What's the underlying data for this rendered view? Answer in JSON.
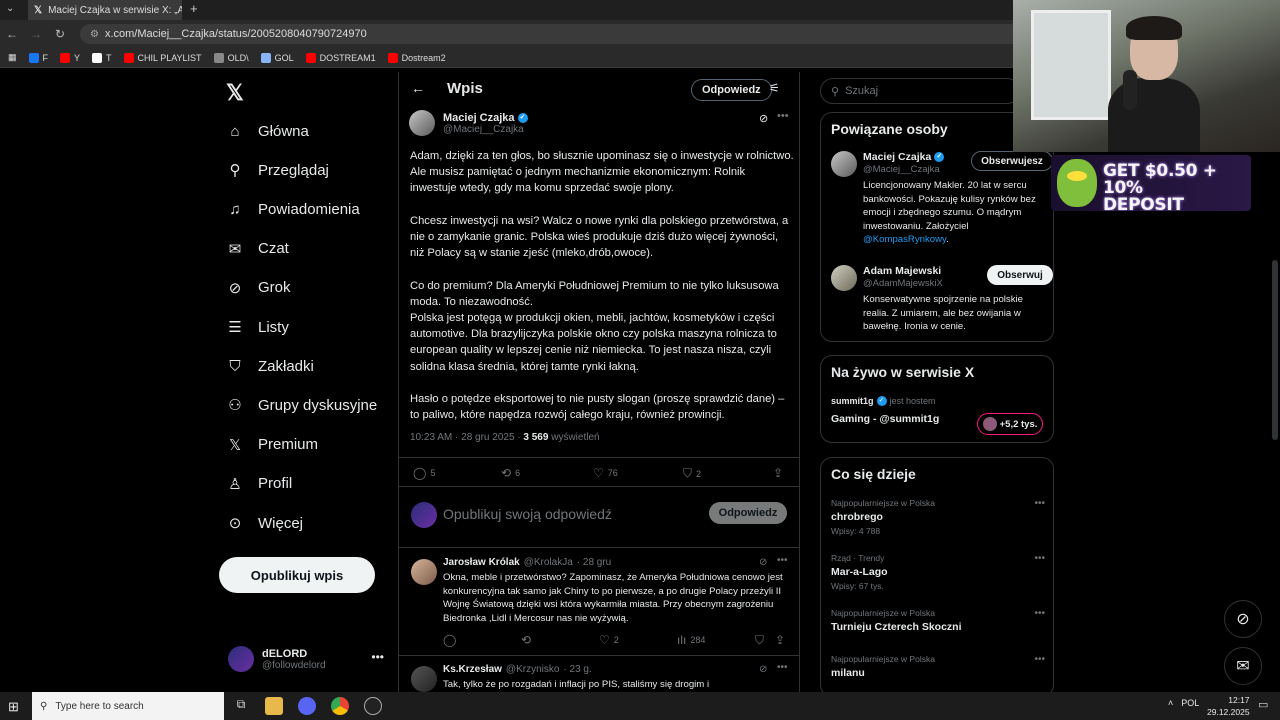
{
  "browser": {
    "tab_title": "Maciej Czajka w serwisie X: „A",
    "url": "x.com/Maciej__Czajka/status/2005208040790724970",
    "bookmarks": [
      {
        "label": "F",
        "color": "#1877f2"
      },
      {
        "label": "Y",
        "color": "#ff0000"
      },
      {
        "label": "T",
        "color": "#ffffff"
      },
      {
        "label": "CHIL PLAYLIST",
        "color": "#ff0000"
      },
      {
        "label": "OLD\\",
        "color": "#888888"
      },
      {
        "label": "GOL",
        "color": "#8ab4f8"
      },
      {
        "label": "DOSTREAM1",
        "color": "#ff0000"
      },
      {
        "label": "Dostream2",
        "color": "#ff0000"
      }
    ]
  },
  "promo": {
    "line1": "GET $0.50 + 10%",
    "line2": "DEPOSIT BONUS"
  },
  "nav": {
    "items": [
      {
        "label": "Główna",
        "icon": "home-icon"
      },
      {
        "label": "Przeglądaj",
        "icon": "search-icon"
      },
      {
        "label": "Powiadomienia",
        "icon": "bell-icon"
      },
      {
        "label": "Czat",
        "icon": "mail-icon"
      },
      {
        "label": "Grok",
        "icon": "grok-icon"
      },
      {
        "label": "Listy",
        "icon": "list-icon"
      },
      {
        "label": "Zakładki",
        "icon": "bookmark-icon"
      },
      {
        "label": "Grupy dyskusyjne",
        "icon": "people-icon"
      },
      {
        "label": "Premium",
        "icon": "x-icon"
      },
      {
        "label": "Profil",
        "icon": "person-icon"
      },
      {
        "label": "Więcej",
        "icon": "more-icon"
      }
    ],
    "post_button": "Opublikuj wpis",
    "account_name": "dELORD",
    "account_handle": "@followdelord"
  },
  "main": {
    "title": "Wpis",
    "reply_pill": "Odpowiedz",
    "author_name": "Maciej Czajka",
    "author_handle": "@Maciej__Czajka",
    "paragraphs": [
      "Adam, dzięki za ten głos, bo słusznie upominasz się o inwestycje w rolnictwo. Ale musisz pamiętać o jednym mechanizmie ekonomicznym: Rolnik inwestuje wtedy, gdy ma komu sprzedać swoje plony.",
      "Chcesz inwestycji na wsi? Walcz o nowe rynki dla polskiego przetwórstwa, a nie o zamykanie granic. Polska wieś produkuje dziś dużo więcej żywności, niż Polacy są w stanie zjeść (mleko,drób,owoce).",
      "Co do premium? Dla Ameryki Południowej Premium to nie tylko luksusowa moda. To niezawodność.\nPolska jest potęgą w produkcji okien, mebli, jachtów, kosmetyków i części automotive. Dla brazylijczyka polskie okno czy polska maszyna rolnicza to european quality w lepszej cenie niż niemiecka. To jest nasza nisza, czyli solidna klasa średnia, której tamte rynki łakną.",
      "Hasło o potędze eksportowej to nie pusty slogan (proszę sprawdzić dane) – to paliwo, które napędza rozwój całego kraju, również prowincji."
    ],
    "time": "10:23 AM · 28 gru 2025 · ",
    "views": "3 569",
    "views_label": " wyświetleń",
    "stats": {
      "replies": "5",
      "reposts": "6",
      "likes": "76",
      "bookmarks": "2"
    },
    "compose_placeholder": "Opublikuj swoją odpowiedź",
    "compose_button": "Odpowiedz",
    "replies": [
      {
        "name": "Jarosław Królak",
        "handle": "@KrolakJa",
        "time": "· 28 gru",
        "text": "Okna, meble i przetwórstwo? Zapominasz, że Ameryka Południowa cenowo jest konkurencyjna tak samo jak Chiny to po pierwsze, a po drugie Polacy przeżyli II Wojnę Światową dzięki wsi która wykarmiła miasta. Przy obecnym zagrożeniu Biedronka ,Lidl i Mercosur nas nie wyżywią.",
        "likes": "2",
        "views": "284"
      },
      {
        "name": "Ks.Krzesław",
        "handle": "@Krzynisko",
        "time": "· 23 g.",
        "text": "Tak, tylko że po rozgadań i inflacji po PIS, staliśmy się drogim i"
      }
    ]
  },
  "right": {
    "search_placeholder": "Szukaj",
    "related_title": "Powiązane osoby",
    "people": [
      {
        "name": "Maciej Czajka",
        "handle": "@Maciej__Czajka",
        "button": "Obserwujesz",
        "bio": "Licencjonowany Makler. 20 lat w sercu bankowości. Pokazuję kulisy rynków bez emocji i zbędnego szumu. O mądrym inwestowaniu. Założyciel ",
        "bio_link": "@KompasRynkowy",
        "bio_end": "."
      },
      {
        "name": "Adam Majewski",
        "handle": "@AdamMajewskiX",
        "button": "Obserwuj",
        "bio": "Konserwatywne spojrzenie na polskie realia. Z umiarem, ale bez owijania w bawełnę. Ironia w cenie."
      }
    ],
    "live_title": "Na żywo w serwisie X",
    "live_host": "summit1g",
    "live_host_suffix": "jest hostem",
    "live_name": "Gaming - @summit1g",
    "live_count": "+5,2 tys.",
    "trends_title": "Co się dzieje",
    "trends": [
      {
        "context": "Najpopularniejsze w Polska",
        "name": "chrobrego",
        "count": "Wpisy: 4 788"
      },
      {
        "context": "Rząd · Trendy",
        "name": "Mar-a-Lago",
        "count": "Wpisy: 67 tys."
      },
      {
        "context": "Najpopularniejsze w Polska",
        "name": "Turnieju Czterech Skoczni",
        "count": ""
      },
      {
        "context": "Najpopularniejsze w Polska",
        "name": "milanu",
        "count": ""
      }
    ]
  },
  "taskbar": {
    "search_placeholder": "Type here to search",
    "lang": "POL",
    "time": "12:17",
    "date": "29.12.2025"
  }
}
